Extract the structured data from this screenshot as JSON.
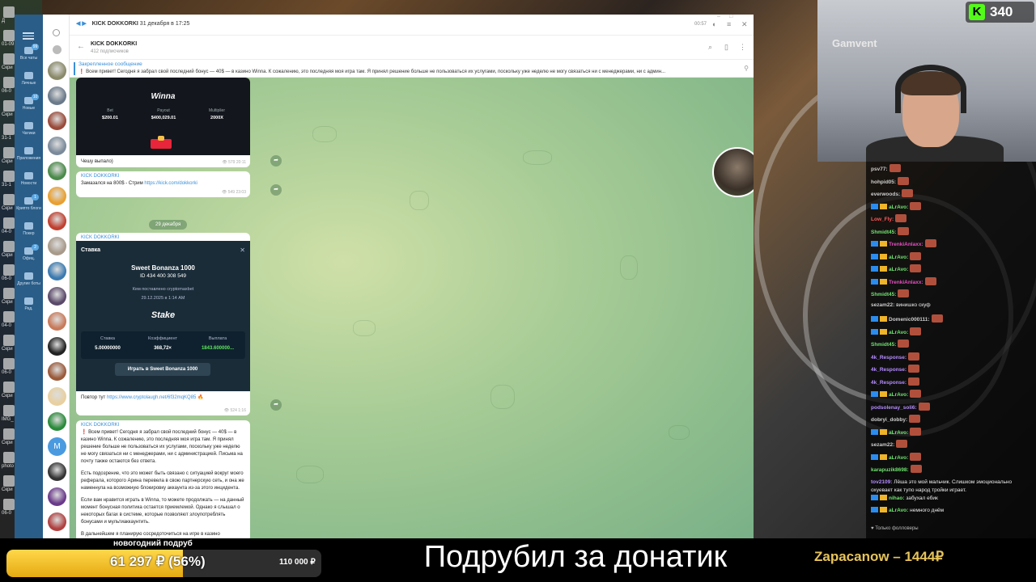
{
  "desktop": {
    "labels": [
      "Д",
      "01-09",
      "Скри",
      "06-0",
      "Скри",
      "31-1",
      "Скри",
      "31-1",
      "Скри",
      "04-0",
      "Скри",
      "06-0",
      "Скри",
      "04-0",
      "Скри",
      "06-0",
      "Скри",
      "IMG_",
      "Скри",
      "photo",
      "Скри",
      "06-0"
    ]
  },
  "telegram": {
    "player": {
      "track": "KICK DOKKORKI",
      "date": "31 декабря в 17:25",
      "time": "00:57"
    },
    "sidebar": [
      {
        "label": "Все чаты",
        "badge": "99"
      },
      {
        "label": "Личные",
        "badge": ""
      },
      {
        "label": "Новые",
        "badge": "10"
      },
      {
        "label": "Чатики",
        "badge": ""
      },
      {
        "label": "Приложения",
        "badge": ""
      },
      {
        "label": "Новости",
        "badge": ""
      },
      {
        "label": "Крипто блоги",
        "badge": "1"
      },
      {
        "label": "Покер",
        "badge": ""
      },
      {
        "label": "Офиц.",
        "badge": "2"
      },
      {
        "label": "Другие боты",
        "badge": ""
      },
      {
        "label": "Ред.",
        "badge": ""
      }
    ],
    "avatar_letter_m": "M",
    "header": {
      "title": "KICK DOKKORKI",
      "subtitle": "412 подписчиков"
    },
    "pinned": {
      "title": "Закрепленное сообщение",
      "text": "❗ Всем привет! Сегодня я забрал свой последний бонус — 40$ — в казино Winna. К сожалению, это последняя моя игра там. Я принял решение больше не пользоваться их услугами, поскольку уже неделю не могу связаться ни с менеджерами, ни с админ..."
    },
    "messages": {
      "winna": {
        "logo": "Winna",
        "bet_label": "Bet",
        "bet_value": "$200.01",
        "payout_label": "Payout",
        "payout_value": "$400,029.01",
        "mult_label": "Multiplier",
        "mult_value": "2000X"
      },
      "m1": {
        "text": "Чешу выпало)",
        "views": "579",
        "time": "20:11"
      },
      "m2": {
        "author": "KICK DOKKORKI",
        "text": "Замазался на 800$ - Стрим ",
        "link": "https://kick.com/dokkorki",
        "views": "549",
        "time": "23:03"
      },
      "date_pill": "29 декабря",
      "m3": {
        "author": "KICK DOKKORKI",
        "stake_header": "Ставка",
        "game": "Sweet Bonanza 1000",
        "id": "ID 434 400 308 549",
        "placed_by": "Кем поставлено  cryptomaxbet",
        "date": "29.12.2025 в 1:14 AM",
        "logo": "Stake",
        "col1_label": "Ставка",
        "col1_value": "5.00000000",
        "col2_label": "Коэффициент",
        "col2_value": "368,72×",
        "col3_label": "Выплата",
        "col3_value": "1843.600000...",
        "play_button": "Играть в Sweet Bonanza 1000",
        "caption": "Повтор тут ",
        "caption_link": "https://www.cryptolaugh.net/6f32mqKQ85",
        "views": "524",
        "time": "1:16"
      },
      "m4": {
        "author": "KICK DOKKORKI",
        "p1": "❗ Всем привет! Сегодня я забрал свой последний бонус — 40$ — в казино Winna. К сожалению, это последняя моя игра там. Я принял решение больше не пользоваться их услугами, поскольку уже неделю не могу связаться ни с менеджерами, ни с администрацией. Письма на почту также остаются без ответа.",
        "p2": "Есть подозрение, что это может быть связано с ситуацией вокруг моего реферала, которого Арина перевела в свою партнерскую сеть, и она же наменнула на возможную блокировку аккаунта из-за этого инцидента.",
        "p3": "Если вам нравится играть в Winna, то можете продолжать — на данный момент бонусная политика остается приемлемой. Однако я слышал о некоторых багах в системе, которые позволяют злоупотреблять бонусами и мультиаккаунтить.",
        "p4": "В дальнейшем я планирую сосредоточиться на игре в казино"
      }
    }
  },
  "stream": {
    "viewers": "340",
    "cam_wall_text": "Gamvent",
    "chat": [
      {
        "user": "psv77:",
        "color": "#cfcfcf",
        "msg": "",
        "badge": false,
        "emote": true
      },
      {
        "user": "hohpid05:",
        "color": "#cfcfcf",
        "msg": "",
        "badge": false,
        "emote": true
      },
      {
        "user": "everwoods:",
        "color": "#cfcfcf",
        "msg": "",
        "badge": false,
        "emote": true
      },
      {
        "user": "aLrAvo:",
        "color": "#6fe36f",
        "msg": "",
        "badge": true,
        "emote": true
      },
      {
        "user": "Low_Fly:",
        "color": "#ff5a5a",
        "msg": "",
        "badge": false,
        "emote": true
      },
      {
        "user": "Shmidt45:",
        "color": "#6fe36f",
        "msg": "",
        "badge": false,
        "emote": true
      },
      {
        "user": "TrenkiAnlaxx:",
        "color": "#e84fc3",
        "msg": "",
        "badge": true,
        "emote": true
      },
      {
        "user": "aLrAvo:",
        "color": "#6fe36f",
        "msg": "",
        "badge": true,
        "emote": true
      },
      {
        "user": "aLrAvo:",
        "color": "#6fe36f",
        "msg": "",
        "badge": true,
        "emote": true
      },
      {
        "user": "TrenkiAnlaxx:",
        "color": "#e84fc3",
        "msg": "",
        "badge": true,
        "emote": true
      },
      {
        "user": "Shmidt45:",
        "color": "#6fe36f",
        "msg": "",
        "badge": false,
        "emote": true
      },
      {
        "user": "sezam22:",
        "color": "#cfcfcf",
        "msg": "винишко скуф",
        "badge": false,
        "emote": false
      },
      {
        "user": "Domenic000111:",
        "color": "#cfcfcf",
        "msg": "",
        "badge": true,
        "emote": true
      },
      {
        "user": "aLrAvo:",
        "color": "#6fe36f",
        "msg": "",
        "badge": true,
        "emote": true
      },
      {
        "user": "Shmidt45:",
        "color": "#6fe36f",
        "msg": "",
        "badge": false,
        "emote": true
      },
      {
        "user": "4k_Response:",
        "color": "#b58cff",
        "msg": "",
        "badge": false,
        "emote": true
      },
      {
        "user": "4k_Response:",
        "color": "#b58cff",
        "msg": "",
        "badge": false,
        "emote": true
      },
      {
        "user": "4k_Response:",
        "color": "#b58cff",
        "msg": "",
        "badge": false,
        "emote": true
      },
      {
        "user": "aLrAvo:",
        "color": "#6fe36f",
        "msg": "",
        "badge": true,
        "emote": true
      },
      {
        "user": "podsolenay_soli6:",
        "color": "#b58cff",
        "msg": "",
        "badge": false,
        "emote": true
      },
      {
        "user": "dobryi_dobby:",
        "color": "#cfcfcf",
        "msg": "",
        "badge": false,
        "emote": true
      },
      {
        "user": "aLrAvo:",
        "color": "#6fe36f",
        "msg": "",
        "badge": true,
        "emote": true
      },
      {
        "user": "sezam22:",
        "color": "#cfcfcf",
        "msg": "",
        "badge": false,
        "emote": true
      },
      {
        "user": "aLrAvo:",
        "color": "#6fe36f",
        "msg": "",
        "badge": true,
        "emote": true
      },
      {
        "user": "karapuzik8698:",
        "color": "#6fe36f",
        "msg": "",
        "badge": false,
        "emote": true
      }
    ],
    "chat_wrapped": [
      {
        "user": "tov2109:",
        "color": "#b58cff",
        "msg": "Лёша это мой мальчик. Слишком эмоционально охуевает как тупо народ тройки играет."
      },
      {
        "user": "nihao:",
        "color": "#6fe36f",
        "msg": "забухал ебик",
        "badge": true
      },
      {
        "user": "aLrAvo:",
        "color": "#6fe36f",
        "msg": "немного днём",
        "badge": true
      }
    ],
    "chat_footer": "♥ Только фолловеры"
  },
  "bottom": {
    "donate_title": "новогодний подруб",
    "donate_current": "61 297 ₽ (56%)",
    "donate_goal": "110 000 ₽",
    "donate_progress": 0.56,
    "stream_title": "Подрубил за донатик",
    "top_donor": "Zapacanow – 1444₽"
  },
  "colors": {
    "kick_green": "#53fc18",
    "telegram_blue": "#2a5d87",
    "donate_gold": "#e5a912"
  }
}
